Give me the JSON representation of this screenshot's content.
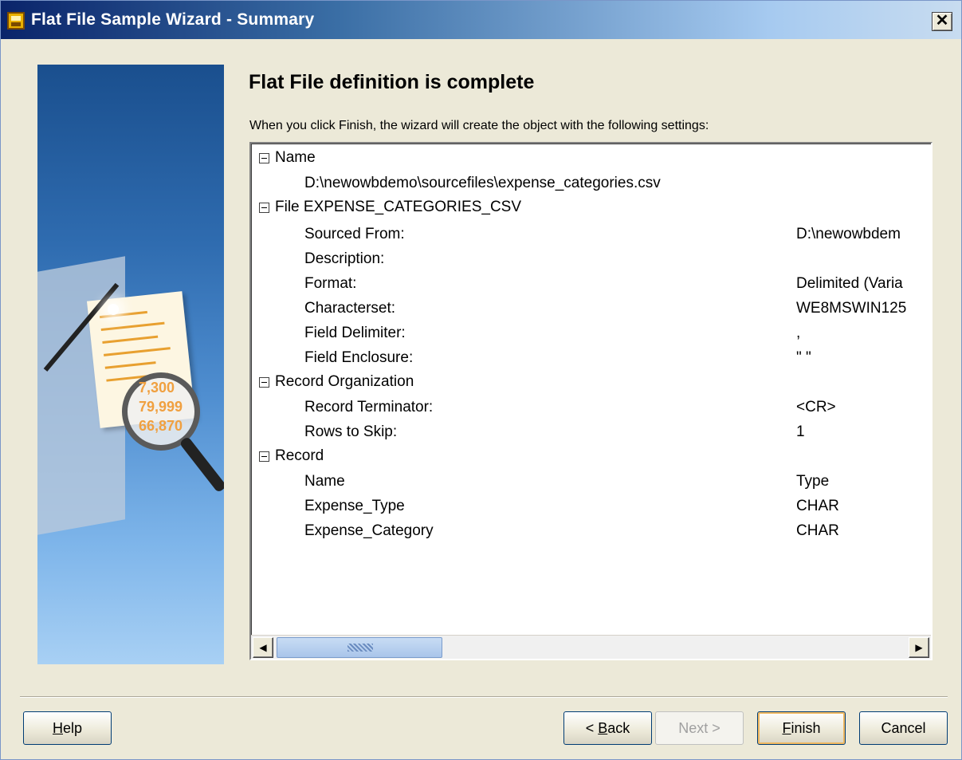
{
  "window": {
    "title": "Flat File Sample Wizard - Summary",
    "close_glyph": "✕"
  },
  "main": {
    "heading": "Flat File definition is complete",
    "subtext": "When you click Finish, the wizard will create the object with the following settings:"
  },
  "tree": {
    "name_section": "Name",
    "name_value": "D:\\newowbdemo\\sourcefiles\\expense_categories.csv",
    "file_section": "File EXPENSE_CATEGORIES_CSV",
    "file_rows": [
      {
        "label": "Sourced From:",
        "value": "D:\\newowbdem"
      },
      {
        "label": "Description:",
        "value": ""
      },
      {
        "label": "Format:",
        "value": "Delimited (Varia"
      },
      {
        "label": "Characterset:",
        "value": "WE8MSWIN125"
      },
      {
        "label": "Field Delimiter:",
        "value": ","
      },
      {
        "label": "Field Enclosure:",
        "value": "\" \""
      }
    ],
    "record_org_section": "Record Organization",
    "record_org_rows": [
      {
        "label": "Record Terminator:",
        "value": "<CR>"
      },
      {
        "label": "Rows to Skip:",
        "value": "1"
      }
    ],
    "record_section": "Record",
    "record_rows": [
      {
        "label": "Name",
        "value": "Type"
      },
      {
        "label": "Expense_Type",
        "value": "CHAR"
      },
      {
        "label": "Expense_Category",
        "value": "CHAR"
      }
    ]
  },
  "scrollbar": {
    "left_arrow": "◀",
    "right_arrow": "▶"
  },
  "buttons": {
    "help": {
      "mnemonic": "H",
      "rest": "elp"
    },
    "back": {
      "prefix": "< ",
      "mnemonic": "B",
      "rest": "ack"
    },
    "next": {
      "label": "Next >"
    },
    "finish": {
      "mnemonic": "F",
      "rest": "inish"
    },
    "cancel": {
      "label": "Cancel"
    }
  },
  "side_image": {
    "numbers": [
      "7,300",
      "79,999",
      "66,870"
    ]
  }
}
